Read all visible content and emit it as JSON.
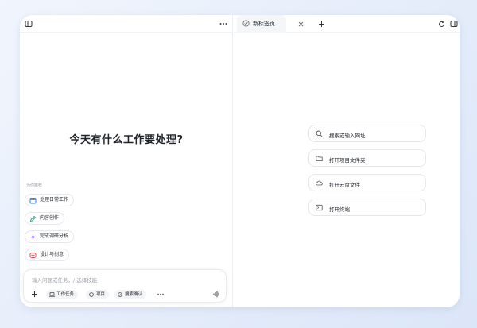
{
  "left_panel": {
    "heading": "今天有什么工作要处理?",
    "section_label": "为你推荐",
    "suggestions": [
      {
        "label": "处理日常工作",
        "icon": "calendar-icon",
        "color": "#3b7cf5"
      },
      {
        "label": "内容创作",
        "icon": "pen-icon",
        "color": "#22a06b"
      },
      {
        "label": "完成调研分析",
        "icon": "sparkle-icon",
        "color": "#8b5cf6"
      },
      {
        "label": "设计与创意",
        "icon": "palette-icon",
        "color": "#e5484d"
      }
    ]
  },
  "composer": {
    "placeholder": "输入问题或任务，/ 选择技能",
    "mode_label": "工作任务",
    "project_label": "项目",
    "search_label": "搜索确认"
  },
  "tabs": [
    {
      "label": "新标签页",
      "active": true
    }
  ],
  "quick_actions": [
    {
      "label": "搜索或输入网址",
      "icon": "search-icon"
    },
    {
      "label": "打开项目文件夹",
      "icon": "folder-icon"
    },
    {
      "label": "打开云盘文件",
      "icon": "cloud-icon"
    },
    {
      "label": "打开终端",
      "icon": "terminal-icon"
    }
  ],
  "colors": {
    "accent": "#3b7cf5",
    "background": "#e4ecfa"
  }
}
